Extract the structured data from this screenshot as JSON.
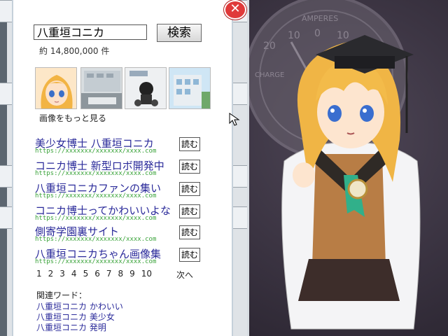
{
  "search": {
    "query": "八重垣コニカ",
    "button_label": "検索",
    "result_count": "約 14,800,000 件"
  },
  "images": {
    "more_label": "画像をもっと見る"
  },
  "results": [
    {
      "title": "美少女博士 八重垣コニカ",
      "url": "https://xxxxxxx/xxxxxxx/xxxx.com",
      "read_label": "読む"
    },
    {
      "title": "コニカ博士 新型ロボ開発中",
      "url": "https://xxxxxxx/xxxxxxx/xxxx.com",
      "read_label": "読む"
    },
    {
      "title": "八重垣コニカファンの集い",
      "url": "https://xxxxxxx/xxxxxxx/xxxx.com",
      "read_label": "読む"
    },
    {
      "title": "コニカ博士ってかわいいよな",
      "url": "https://xxxxxxx/xxxxxxx/xxxx.com",
      "read_label": "読む"
    },
    {
      "title": "側寄学園裏サイト",
      "url": "https://xxxxxxx/xxxxxxx/xxxx.com",
      "read_label": "読む"
    },
    {
      "title": "八重垣コニカちゃん画像集",
      "url": "https://xxxxxxx/xxxxxxx/xxxx.com",
      "read_label": "読む"
    }
  ],
  "pagination": {
    "pages": [
      "1",
      "2",
      "3",
      "4",
      "5",
      "6",
      "7",
      "8",
      "9",
      "10"
    ],
    "next_label": "次へ"
  },
  "related": {
    "heading": "関連ワード：",
    "items": [
      "八重垣コニカ かわいい",
      "八重垣コニカ 美少女",
      "八重垣コニカ 発明"
    ]
  },
  "gauge": {
    "label_top": "AMPERES",
    "scale": [
      "20",
      "10",
      "0",
      "10"
    ],
    "label_side": "CHARGE"
  },
  "colors": {
    "link": "#2a2a9a",
    "url": "#3aa33a",
    "close": "#e03a3a",
    "background_art": "#3b3442"
  }
}
